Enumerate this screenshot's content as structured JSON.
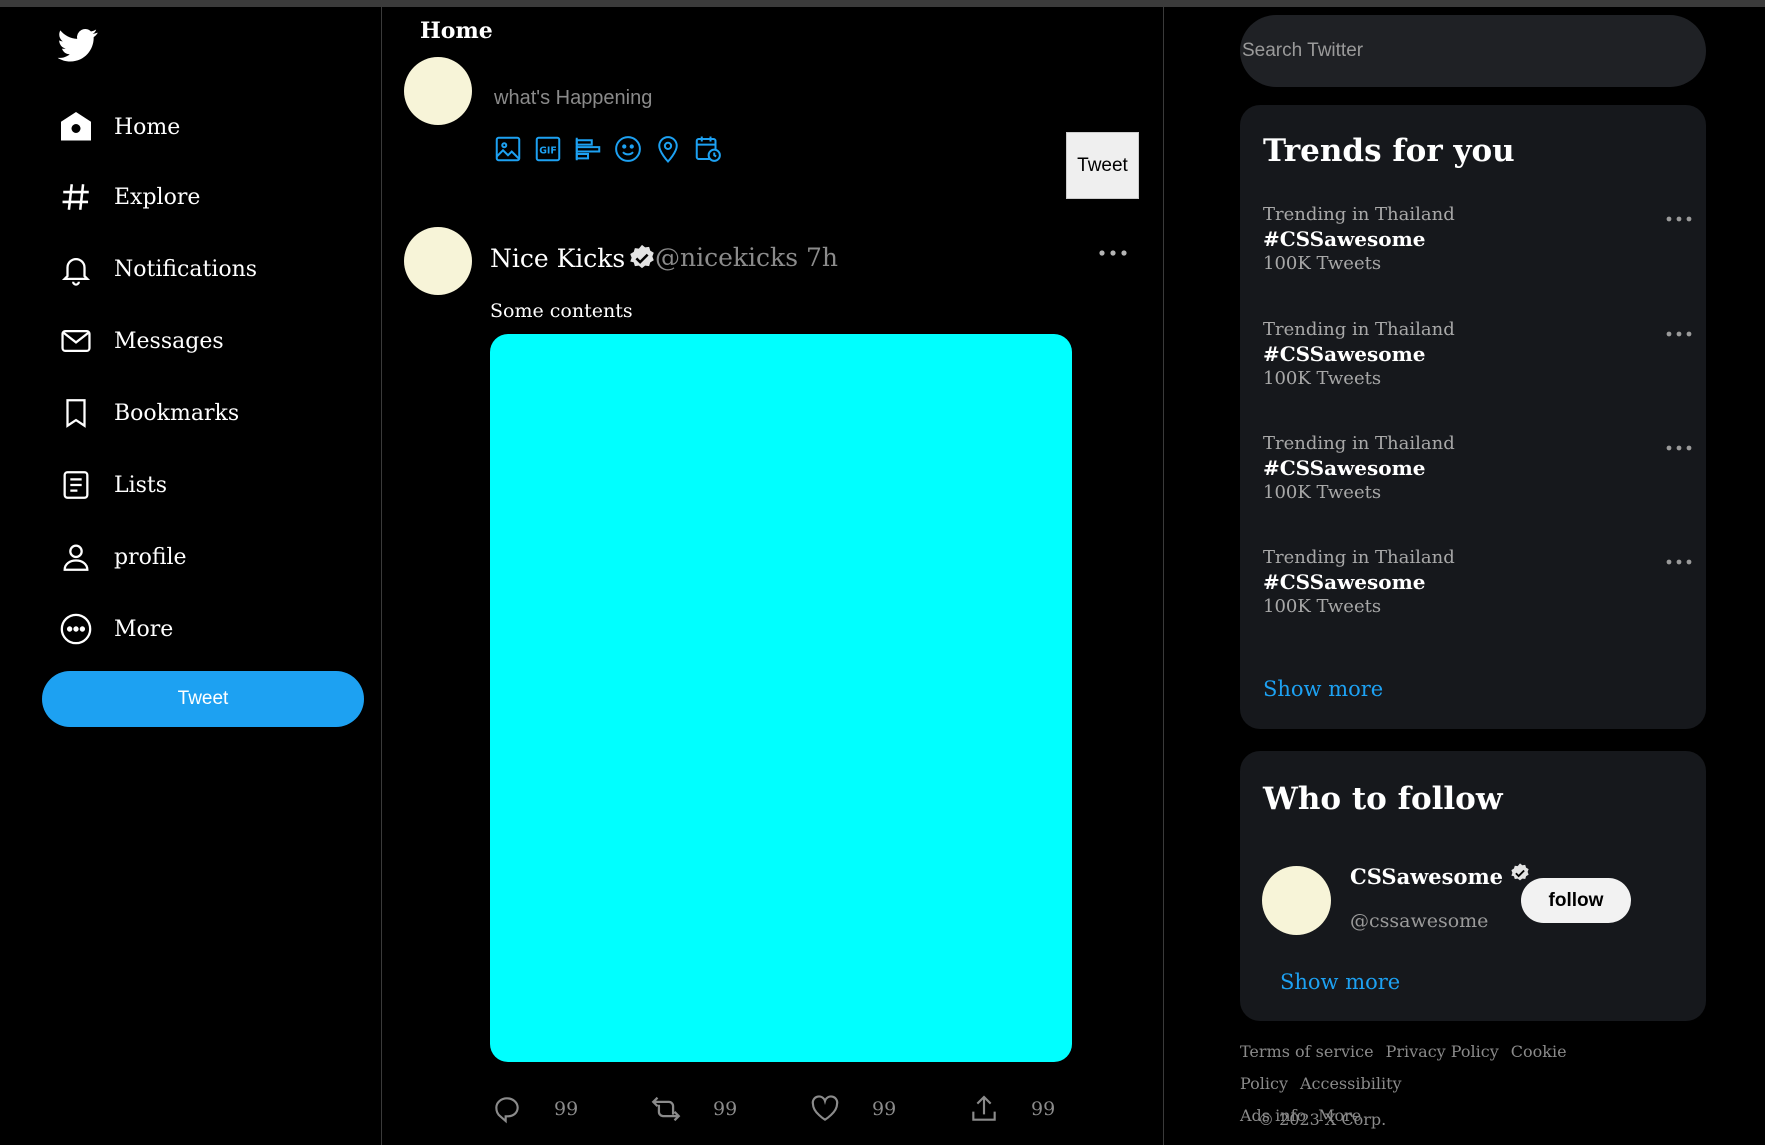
{
  "nav": {
    "items": [
      {
        "label": "Home",
        "icon": "home-icon"
      },
      {
        "label": "Explore",
        "icon": "hashtag-icon"
      },
      {
        "label": "Notifications",
        "icon": "bell-icon"
      },
      {
        "label": "Messages",
        "icon": "mail-icon"
      },
      {
        "label": "Bookmarks",
        "icon": "bookmark-icon"
      },
      {
        "label": "Lists",
        "icon": "list-icon"
      },
      {
        "label": "profile",
        "icon": "user-icon"
      },
      {
        "label": "More",
        "icon": "more-circle-icon"
      }
    ],
    "tweet_button": "Tweet"
  },
  "feed": {
    "title": "Home",
    "compose": {
      "placeholder": "what's Happening",
      "tweet_button": "Tweet"
    },
    "post": {
      "name": "Nice Kicks",
      "handle": "@nicekicks 7h",
      "content": "Some contents",
      "media_color": "#00ffff",
      "actions": {
        "reply": "99",
        "retweet": "99",
        "like": "99",
        "share": "99"
      }
    }
  },
  "sidebar": {
    "search_placeholder": "Search Twitter",
    "trends": {
      "title": "Trends for you",
      "items": [
        {
          "context": "Trending in Thailand",
          "tag": "#CSSawesome",
          "count": "100K Tweets"
        },
        {
          "context": "Trending in Thailand",
          "tag": "#CSSawesome",
          "count": "100K Tweets"
        },
        {
          "context": "Trending in Thailand",
          "tag": "#CSSawesome",
          "count": "100K Tweets"
        },
        {
          "context": "Trending in Thailand",
          "tag": "#CSSawesome",
          "count": "100K Tweets"
        }
      ],
      "show_more": "Show more"
    },
    "who_to_follow": {
      "title": "Who to follow",
      "name": "CSSawesome",
      "handle": "@cssawesome",
      "follow_button": "follow",
      "show_more": "Show more"
    },
    "footer": {
      "links": [
        "Terms of service",
        "Privacy Policy",
        "Cookie Policy",
        "Accessibility",
        "Ads info",
        "More"
      ],
      "copyright": "© 2023 X Corp."
    }
  },
  "colors": {
    "accent": "#1da1f2",
    "card_bg": "#16181c",
    "avatar": "#f7f4d8"
  }
}
